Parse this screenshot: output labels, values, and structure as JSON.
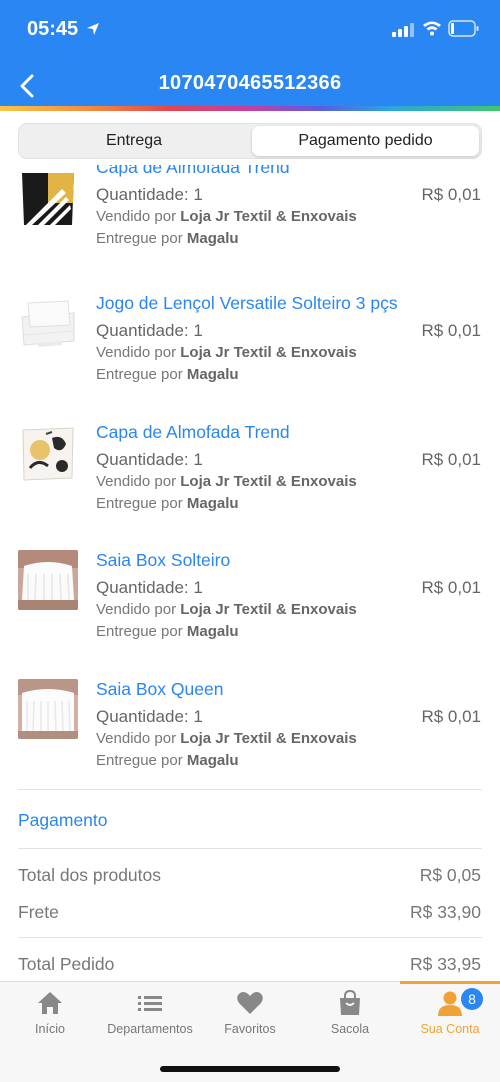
{
  "status_bar": {
    "time": "05:45"
  },
  "header": {
    "title": "1070470465512366"
  },
  "segments": {
    "delivery": "Entrega",
    "payment": "Pagamento pedido"
  },
  "items": [
    {
      "name": "Capa de Almofada Trend",
      "qty": "Quantidade: 1",
      "price": "R$ 0,01",
      "sold_prefix": "Vendido por",
      "seller": "Loja Jr Textil & Enxovais",
      "deliv_prefix": "Entregue por",
      "deliverer": "Magalu"
    },
    {
      "name": "Jogo de Lençol Versatile  Solteiro 3 pçs",
      "qty": "Quantidade: 1",
      "price": "R$ 0,01",
      "sold_prefix": "Vendido por",
      "seller": "Loja Jr Textil & Enxovais",
      "deliv_prefix": "Entregue por",
      "deliverer": "Magalu"
    },
    {
      "name": "Capa de Almofada Trend",
      "qty": "Quantidade: 1",
      "price": "R$ 0,01",
      "sold_prefix": "Vendido por",
      "seller": "Loja Jr Textil & Enxovais",
      "deliv_prefix": "Entregue por",
      "deliverer": "Magalu"
    },
    {
      "name": "Saia Box Solteiro",
      "qty": "Quantidade: 1",
      "price": "R$ 0,01",
      "sold_prefix": "Vendido por",
      "seller": "Loja Jr Textil & Enxovais",
      "deliv_prefix": "Entregue por",
      "deliverer": "Magalu"
    },
    {
      "name": "Saia Box Queen",
      "qty": "Quantidade: 1",
      "price": "R$ 0,01",
      "sold_prefix": "Vendido por",
      "seller": "Loja Jr Textil & Enxovais",
      "deliv_prefix": "Entregue por",
      "deliverer": "Magalu"
    }
  ],
  "payment": {
    "title": "Pagamento",
    "products_label": "Total dos produtos",
    "products_value": "R$ 0,05",
    "shipping_label": "Frete",
    "shipping_value": "R$ 33,90",
    "total_label": "Total Pedido",
    "total_value": "R$ 33,95"
  },
  "tabbar": {
    "tabs": [
      {
        "label": "Início",
        "icon": "home-icon"
      },
      {
        "label": "Departamentos",
        "icon": "list-icon"
      },
      {
        "label": "Favoritos",
        "icon": "heart-icon"
      },
      {
        "label": "Sacola",
        "icon": "bag-icon"
      },
      {
        "label": "Sua Conta",
        "icon": "user-icon",
        "active": true
      }
    ],
    "badge": "8"
  },
  "colors": {
    "brand": "#2a86f3",
    "active_tab": "#f0a234"
  }
}
